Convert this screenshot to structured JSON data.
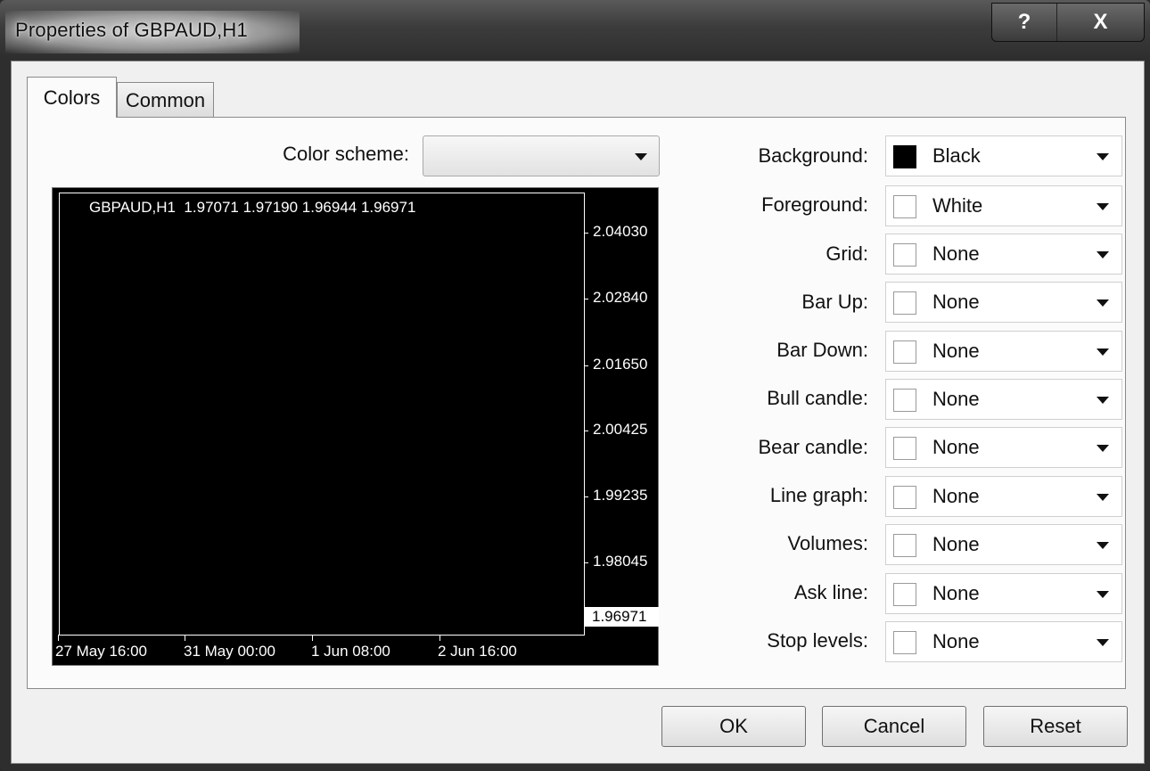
{
  "window": {
    "title": "Properties of GBPAUD,H1",
    "help_label": "?",
    "close_label": "X"
  },
  "tabs": [
    {
      "label": "Colors",
      "active": true
    },
    {
      "label": "Common",
      "active": false
    }
  ],
  "color_scheme": {
    "label": "Color scheme:",
    "value": ""
  },
  "preview": {
    "title": "GBPAUD,H1  1.97071 1.97190 1.96944 1.96971",
    "prices": [
      "2.04030",
      "2.02840",
      "2.01650",
      "2.00425",
      "1.99235",
      "1.98045"
    ],
    "current_price": "1.96971",
    "times": [
      "27 May 16:00",
      "31 May 00:00",
      "1 Jun 08:00",
      "2 Jun 16:00"
    ]
  },
  "color_rows": [
    {
      "label": "Background:",
      "value": "Black",
      "swatch": "#000000"
    },
    {
      "label": "Foreground:",
      "value": "White",
      "swatch": "#ffffff"
    },
    {
      "label": "Grid:",
      "value": "None",
      "swatch": "#ffffff"
    },
    {
      "label": "Bar Up:",
      "value": "None",
      "swatch": "#ffffff"
    },
    {
      "label": "Bar Down:",
      "value": "None",
      "swatch": "#ffffff"
    },
    {
      "label": "Bull candle:",
      "value": "None",
      "swatch": "#ffffff"
    },
    {
      "label": "Bear candle:",
      "value": "None",
      "swatch": "#ffffff"
    },
    {
      "label": "Line graph:",
      "value": "None",
      "swatch": "#ffffff"
    },
    {
      "label": "Volumes:",
      "value": "None",
      "swatch": "#ffffff"
    },
    {
      "label": "Ask line:",
      "value": "None",
      "swatch": "#ffffff"
    },
    {
      "label": "Stop levels:",
      "value": "None",
      "swatch": "#ffffff"
    }
  ],
  "buttons": {
    "ok": "OK",
    "cancel": "Cancel",
    "reset": "Reset"
  }
}
